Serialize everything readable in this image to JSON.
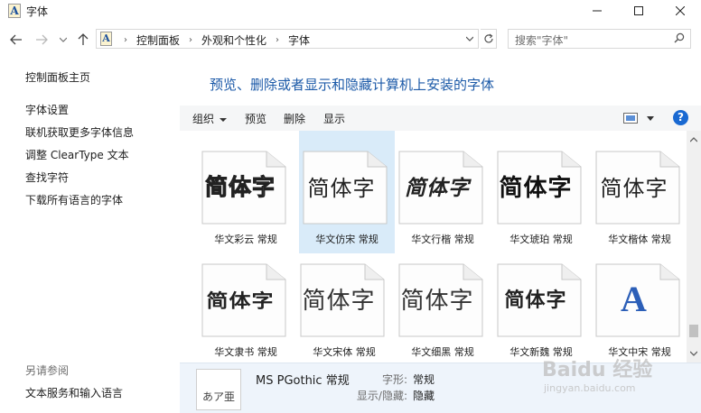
{
  "window": {
    "title": "字体",
    "app_icon_letter": "A"
  },
  "address": {
    "crumbs": [
      "控制面板",
      "外观和个性化",
      "字体"
    ],
    "search_placeholder": "搜索\"字体\""
  },
  "left_pane": {
    "links": [
      "控制面板主页",
      "字体设置",
      "联机获取更多字体信息",
      "调整 ClearType 文本",
      "查找字符",
      "下载所有语言的字体"
    ],
    "see_also_heading": "另请参阅",
    "see_also_links": [
      "文本服务和输入语言"
    ]
  },
  "main": {
    "title": "预览、删除或者显示和隐藏计算机上安装的字体",
    "cut_label": "常规"
  },
  "toolbar": {
    "organize": "组织",
    "preview": "预览",
    "delete": "删除",
    "show": "显示",
    "help": "?"
  },
  "fonts": [
    {
      "sample": "简体字",
      "label": "华文彩云 常规",
      "selected": false
    },
    {
      "sample": "简体字",
      "label": "华文仿宋 常规",
      "selected": true
    },
    {
      "sample": "简体字",
      "label": "华文行楷 常规",
      "selected": false
    },
    {
      "sample": "简体字",
      "label": "华文琥珀 常规",
      "selected": false
    },
    {
      "sample": "简体字",
      "label": "华文楷体 常规",
      "selected": false
    },
    {
      "sample": "简体字",
      "label": "华文隶书 常规",
      "selected": false
    },
    {
      "sample": "简体字",
      "label": "华文宋体 常规",
      "selected": false
    },
    {
      "sample": "简体字",
      "label": "华文细黑 常规",
      "selected": false
    },
    {
      "sample": "简体字",
      "label": "华文新魏 常规",
      "selected": false
    },
    {
      "sample": "A",
      "label": "华文中宋 常规",
      "selected": false
    }
  ],
  "details": {
    "preview_text": "あア亜",
    "name": "MS PGothic 常规",
    "style_key": "字形:",
    "style_value": "常规",
    "visibility_key": "显示/隐藏:",
    "visibility_value": "隐藏"
  },
  "watermark": {
    "main": "Baidu 经验",
    "sub": "jingyan.baidu.com"
  },
  "colors": {
    "accent": "#1c5aa8",
    "selection": "#d9ebf9",
    "help": "#1969d2"
  }
}
